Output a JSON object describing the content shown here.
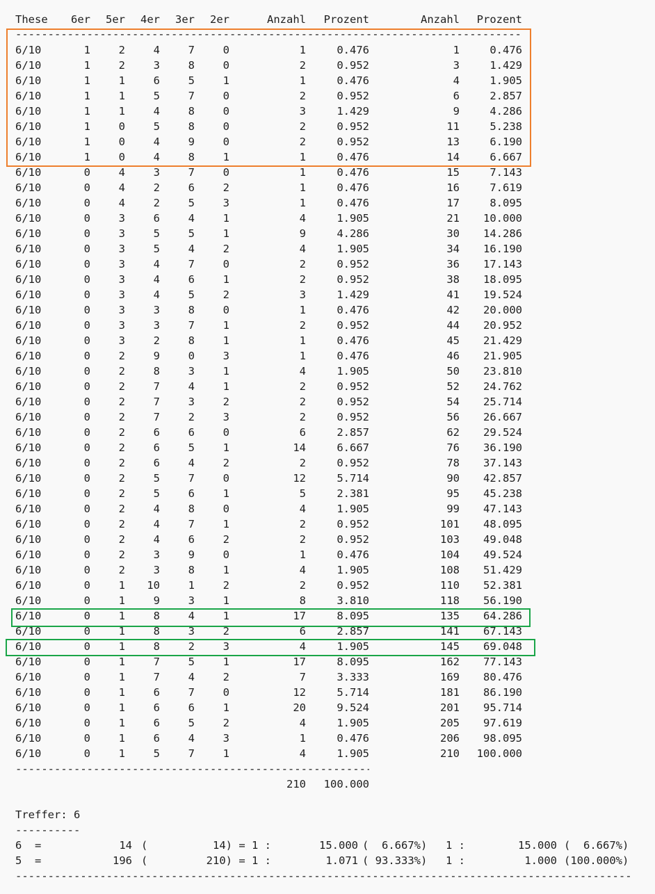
{
  "colors": {
    "orange_box": "#ee7f2d",
    "green_box": "#1aa548",
    "text": "#1e1e1e",
    "background": "#f9f9f9"
  },
  "headers": [
    "These",
    "6er",
    "5er",
    "4er",
    "3er",
    "2er",
    "Anzahl",
    "Prozent",
    "Anzahl",
    "Prozent"
  ],
  "separator_top": "--------------------------------------------------------------------------------------------------------------------------------------------------------------------------",
  "rows": [
    [
      "6/10",
      "1",
      "2",
      "4",
      "7",
      "0",
      "1",
      "0.476",
      "1",
      "0.476"
    ],
    [
      "6/10",
      "1",
      "2",
      "3",
      "8",
      "0",
      "2",
      "0.952",
      "3",
      "1.429"
    ],
    [
      "6/10",
      "1",
      "1",
      "6",
      "5",
      "1",
      "1",
      "0.476",
      "4",
      "1.905"
    ],
    [
      "6/10",
      "1",
      "1",
      "5",
      "7",
      "0",
      "2",
      "0.952",
      "6",
      "2.857"
    ],
    [
      "6/10",
      "1",
      "1",
      "4",
      "8",
      "0",
      "3",
      "1.429",
      "9",
      "4.286"
    ],
    [
      "6/10",
      "1",
      "0",
      "5",
      "8",
      "0",
      "2",
      "0.952",
      "11",
      "5.238"
    ],
    [
      "6/10",
      "1",
      "0",
      "4",
      "9",
      "0",
      "2",
      "0.952",
      "13",
      "6.190"
    ],
    [
      "6/10",
      "1",
      "0",
      "4",
      "8",
      "1",
      "1",
      "0.476",
      "14",
      "6.667"
    ],
    [
      "6/10",
      "0",
      "4",
      "3",
      "7",
      "0",
      "1",
      "0.476",
      "15",
      "7.143"
    ],
    [
      "6/10",
      "0",
      "4",
      "2",
      "6",
      "2",
      "1",
      "0.476",
      "16",
      "7.619"
    ],
    [
      "6/10",
      "0",
      "4",
      "2",
      "5",
      "3",
      "1",
      "0.476",
      "17",
      "8.095"
    ],
    [
      "6/10",
      "0",
      "3",
      "6",
      "4",
      "1",
      "4",
      "1.905",
      "21",
      "10.000"
    ],
    [
      "6/10",
      "0",
      "3",
      "5",
      "5",
      "1",
      "9",
      "4.286",
      "30",
      "14.286"
    ],
    [
      "6/10",
      "0",
      "3",
      "5",
      "4",
      "2",
      "4",
      "1.905",
      "34",
      "16.190"
    ],
    [
      "6/10",
      "0",
      "3",
      "4",
      "7",
      "0",
      "2",
      "0.952",
      "36",
      "17.143"
    ],
    [
      "6/10",
      "0",
      "3",
      "4",
      "6",
      "1",
      "2",
      "0.952",
      "38",
      "18.095"
    ],
    [
      "6/10",
      "0",
      "3",
      "4",
      "5",
      "2",
      "3",
      "1.429",
      "41",
      "19.524"
    ],
    [
      "6/10",
      "0",
      "3",
      "3",
      "8",
      "0",
      "1",
      "0.476",
      "42",
      "20.000"
    ],
    [
      "6/10",
      "0",
      "3",
      "3",
      "7",
      "1",
      "2",
      "0.952",
      "44",
      "20.952"
    ],
    [
      "6/10",
      "0",
      "3",
      "2",
      "8",
      "1",
      "1",
      "0.476",
      "45",
      "21.429"
    ],
    [
      "6/10",
      "0",
      "2",
      "9",
      "0",
      "3",
      "1",
      "0.476",
      "46",
      "21.905"
    ],
    [
      "6/10",
      "0",
      "2",
      "8",
      "3",
      "1",
      "4",
      "1.905",
      "50",
      "23.810"
    ],
    [
      "6/10",
      "0",
      "2",
      "7",
      "4",
      "1",
      "2",
      "0.952",
      "52",
      "24.762"
    ],
    [
      "6/10",
      "0",
      "2",
      "7",
      "3",
      "2",
      "2",
      "0.952",
      "54",
      "25.714"
    ],
    [
      "6/10",
      "0",
      "2",
      "7",
      "2",
      "3",
      "2",
      "0.952",
      "56",
      "26.667"
    ],
    [
      "6/10",
      "0",
      "2",
      "6",
      "6",
      "0",
      "6",
      "2.857",
      "62",
      "29.524"
    ],
    [
      "6/10",
      "0",
      "2",
      "6",
      "5",
      "1",
      "14",
      "6.667",
      "76",
      "36.190"
    ],
    [
      "6/10",
      "0",
      "2",
      "6",
      "4",
      "2",
      "2",
      "0.952",
      "78",
      "37.143"
    ],
    [
      "6/10",
      "0",
      "2",
      "5",
      "7",
      "0",
      "12",
      "5.714",
      "90",
      "42.857"
    ],
    [
      "6/10",
      "0",
      "2",
      "5",
      "6",
      "1",
      "5",
      "2.381",
      "95",
      "45.238"
    ],
    [
      "6/10",
      "0",
      "2",
      "4",
      "8",
      "0",
      "4",
      "1.905",
      "99",
      "47.143"
    ],
    [
      "6/10",
      "0",
      "2",
      "4",
      "7",
      "1",
      "2",
      "0.952",
      "101",
      "48.095"
    ],
    [
      "6/10",
      "0",
      "2",
      "4",
      "6",
      "2",
      "2",
      "0.952",
      "103",
      "49.048"
    ],
    [
      "6/10",
      "0",
      "2",
      "3",
      "9",
      "0",
      "1",
      "0.476",
      "104",
      "49.524"
    ],
    [
      "6/10",
      "0",
      "2",
      "3",
      "8",
      "1",
      "4",
      "1.905",
      "108",
      "51.429"
    ],
    [
      "6/10",
      "0",
      "1",
      "10",
      "1",
      "2",
      "2",
      "0.952",
      "110",
      "52.381"
    ],
    [
      "6/10",
      "0",
      "1",
      "9",
      "3",
      "1",
      "8",
      "3.810",
      "118",
      "56.190"
    ],
    [
      "6/10",
      "0",
      "1",
      "8",
      "4",
      "1",
      "17",
      "8.095",
      "135",
      "64.286"
    ],
    [
      "6/10",
      "0",
      "1",
      "8",
      "3",
      "2",
      "6",
      "2.857",
      "141",
      "67.143"
    ],
    [
      "6/10",
      "0",
      "1",
      "8",
      "2",
      "3",
      "4",
      "1.905",
      "145",
      "69.048"
    ],
    [
      "6/10",
      "0",
      "1",
      "7",
      "5",
      "1",
      "17",
      "8.095",
      "162",
      "77.143"
    ],
    [
      "6/10",
      "0",
      "1",
      "7",
      "4",
      "2",
      "7",
      "3.333",
      "169",
      "80.476"
    ],
    [
      "6/10",
      "0",
      "1",
      "6",
      "7",
      "0",
      "12",
      "5.714",
      "181",
      "86.190"
    ],
    [
      "6/10",
      "0",
      "1",
      "6",
      "6",
      "1",
      "20",
      "9.524",
      "201",
      "95.714"
    ],
    [
      "6/10",
      "0",
      "1",
      "6",
      "5",
      "2",
      "4",
      "1.905",
      "205",
      "97.619"
    ],
    [
      "6/10",
      "0",
      "1",
      "6",
      "4",
      "3",
      "1",
      "0.476",
      "206",
      "98.095"
    ],
    [
      "6/10",
      "0",
      "1",
      "5",
      "7",
      "1",
      "4",
      "1.905",
      "210",
      "100.000"
    ]
  ],
  "separator_mid": "--------------------------------------------------------------------------------------------------------------------------------------------------------------------------",
  "total": {
    "anzahl": "210",
    "prozent": "100.000"
  },
  "treffer_label": "Treffer: 6",
  "treffer_underline": "----------",
  "summary": [
    {
      "left": "6  =",
      "count": "14",
      "open": "(",
      "cum": "14) = 1 :",
      "ratio": "15.000",
      "pct": "(  6.667%)",
      "one": "1 :",
      "ratio2": "15.000",
      "pct2": "(  6.667%)"
    },
    {
      "left": "5  =",
      "count": "196",
      "open": "(",
      "cum": "210) = 1 :",
      "ratio": "1.071",
      "pct": "( 93.333%)",
      "one": "1 :",
      "ratio2": "1.000",
      "pct2": "(100.000%)"
    }
  ],
  "separator_bottom": "--------------------------------------------------------------------------------------------------------------------------------------------------------------------------"
}
